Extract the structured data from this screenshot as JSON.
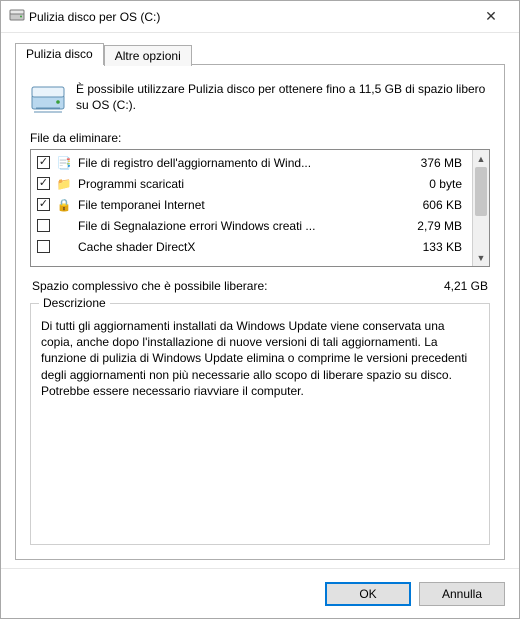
{
  "window": {
    "title": "Pulizia disco per OS (C:)"
  },
  "tabs": {
    "cleanup": "Pulizia disco",
    "more": "Altre opzioni"
  },
  "intro": "È possibile utilizzare Pulizia disco per ottenere fino a 11,5 GB di spazio libero su OS (C:).",
  "files_label": "File da eliminare:",
  "items": [
    {
      "checked": true,
      "name": "File di registro dell'aggiornamento di Wind...",
      "size": "376 MB",
      "icon": "📑"
    },
    {
      "checked": true,
      "name": "Programmi scaricati",
      "size": "0 byte",
      "icon": "📁"
    },
    {
      "checked": true,
      "name": "File temporanei Internet",
      "size": "606 KB",
      "icon": "🔒"
    },
    {
      "checked": false,
      "name": "File di Segnalazione errori Windows creati ...",
      "size": "2,79 MB",
      "icon": ""
    },
    {
      "checked": false,
      "name": "Cache shader DirectX",
      "size": "133 KB",
      "icon": ""
    }
  ],
  "total": {
    "label": "Spazio complessivo che è possibile liberare:",
    "value": "4,21 GB"
  },
  "description": {
    "title": "Descrizione",
    "text": "Di tutti gli aggiornamenti installati da Windows Update viene conservata una copia, anche dopo l'installazione di nuove versioni di tali aggiornamenti. La funzione di pulizia di Windows Update elimina o comprime le versioni precedenti degli aggiornamenti non più necessarie allo scopo di liberare spazio su disco. Potrebbe essere necessario riavviare il computer."
  },
  "buttons": {
    "ok": "OK",
    "cancel": "Annulla"
  }
}
